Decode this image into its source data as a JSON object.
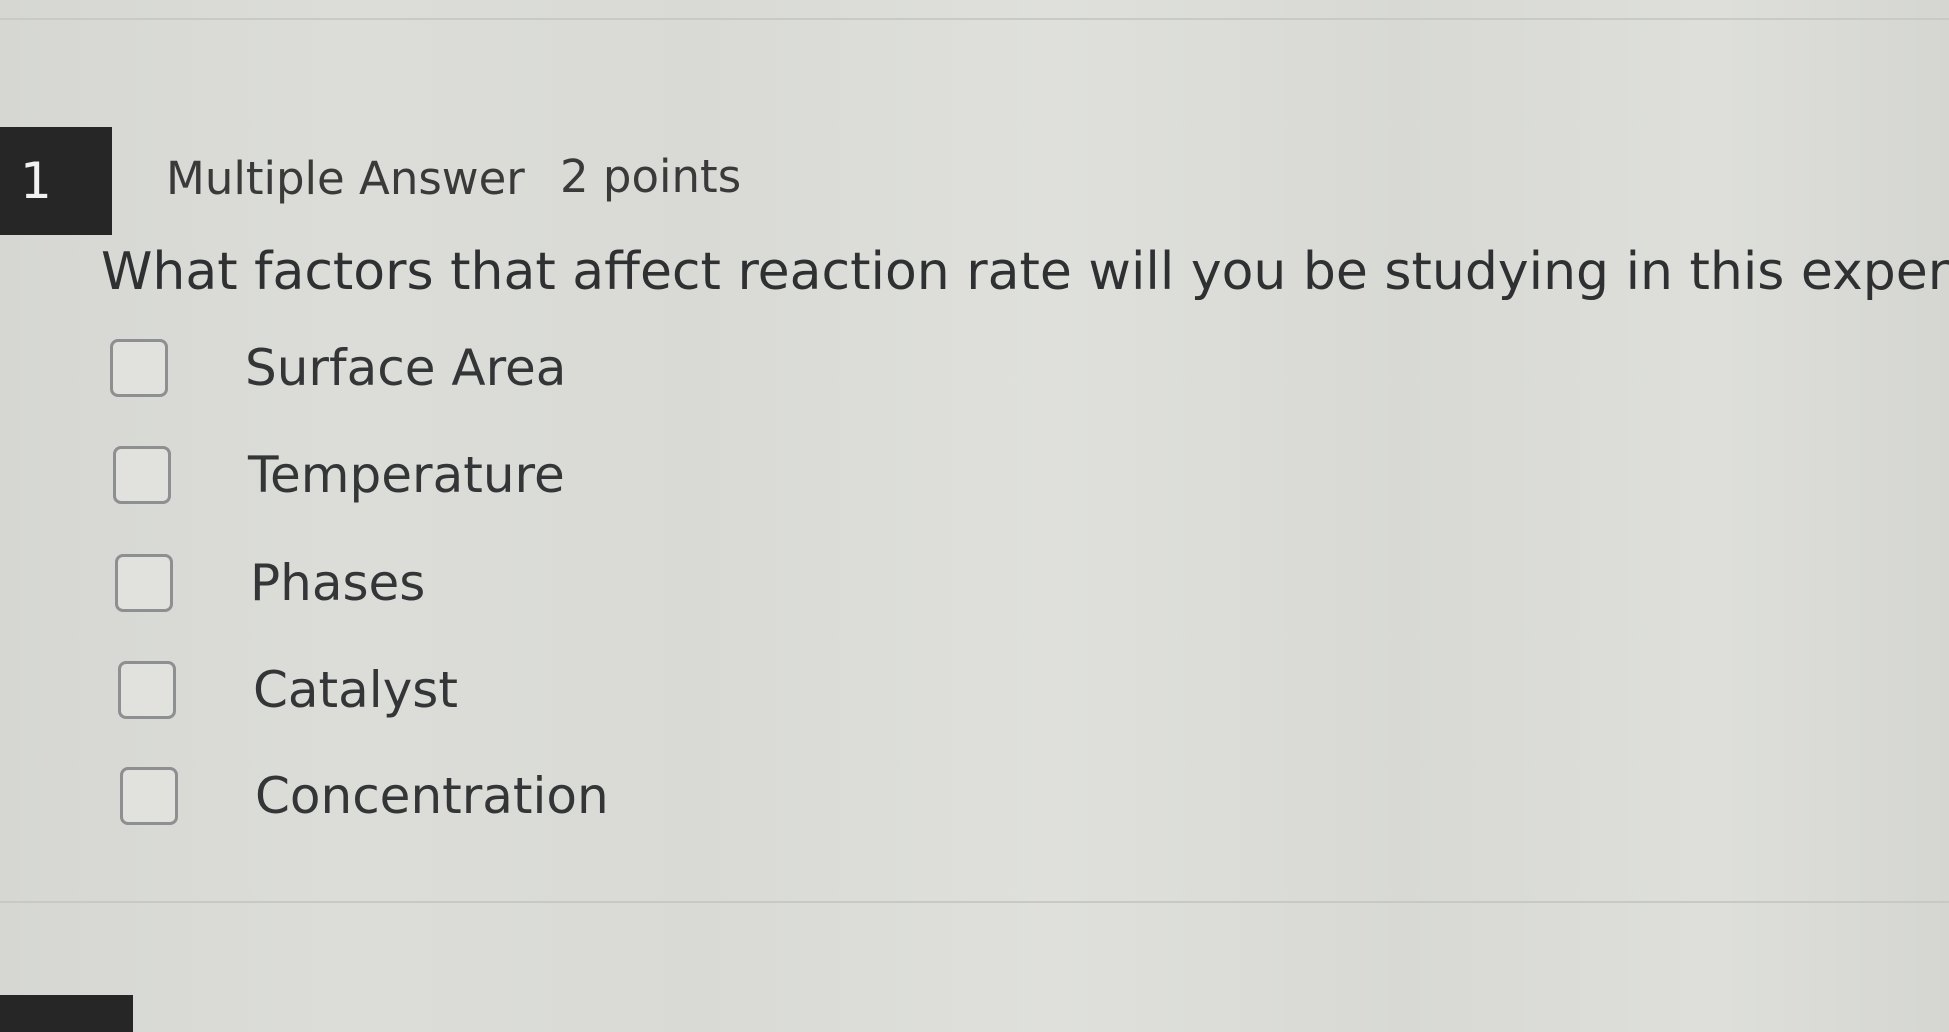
{
  "question": {
    "number": "1",
    "type": "Multiple Answer",
    "points": "2 points",
    "prompt": "What factors that affect reaction rate will you be studying in this experiment?"
  },
  "options": [
    {
      "label": "Surface Area",
      "checked": false
    },
    {
      "label": "Temperature",
      "checked": false
    },
    {
      "label": "Phases",
      "checked": false
    },
    {
      "label": "Catalyst",
      "checked": false
    },
    {
      "label": "Concentration",
      "checked": false
    }
  ],
  "colors": {
    "background": "#d9dad6",
    "number_badge": "#262626",
    "text": "#2f3133",
    "checkbox_border": "#8d8f90"
  }
}
